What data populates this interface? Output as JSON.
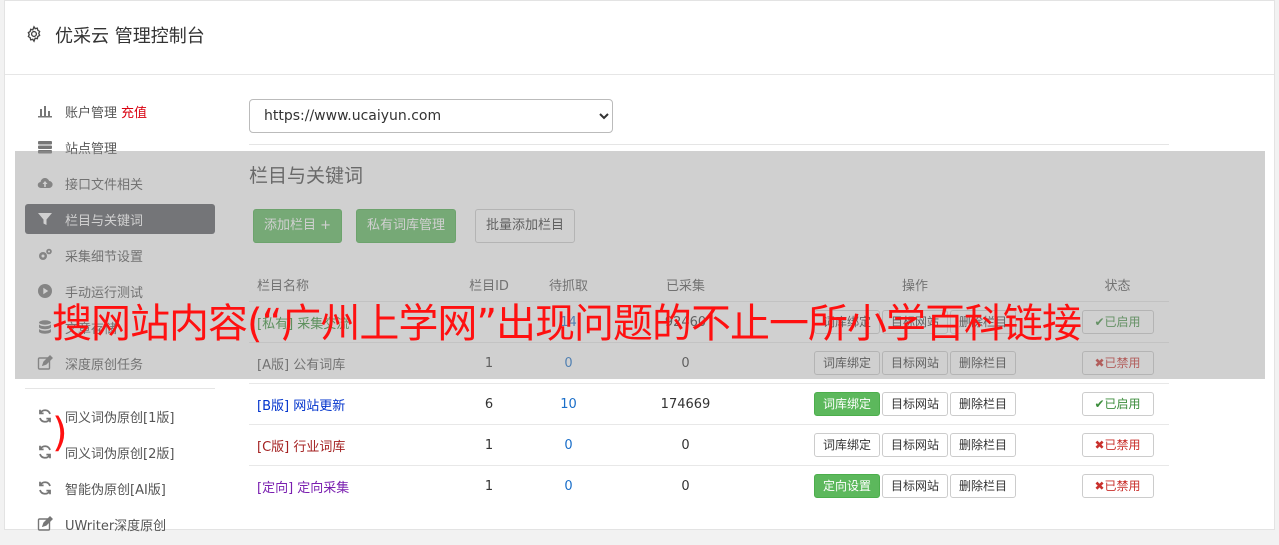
{
  "header": {
    "title": "优采云 管理控制台"
  },
  "sidebar": {
    "items": [
      {
        "label": "账户管理",
        "extra": "充值",
        "icon": "bar-chart-icon"
      },
      {
        "label": "站点管理",
        "icon": "server-icon"
      },
      {
        "label": "接口文件相关",
        "icon": "cloud-upload-icon"
      },
      {
        "label": "栏目与关键词",
        "icon": "filter-icon",
        "active": true
      },
      {
        "label": "采集细节设置",
        "icon": "cogs-icon"
      },
      {
        "label": "手动运行测试",
        "icon": "play-circle-icon"
      },
      {
        "label": "文章存储",
        "icon": "database-icon"
      },
      {
        "label": "深度原创任务",
        "icon": "edit-icon"
      }
    ],
    "tools": [
      {
        "label": "同义词伪原创[1版]",
        "icon": "refresh-icon"
      },
      {
        "label": "同义词伪原创[2版]",
        "icon": "refresh-icon"
      },
      {
        "label": "智能伪原创[AI版]",
        "icon": "refresh-icon"
      },
      {
        "label": "UWriter深度原创",
        "icon": "edit-icon"
      }
    ]
  },
  "main": {
    "site_select": {
      "value": "https://www.ucaiyun.com",
      "options": [
        "https://www.ucaiyun.com"
      ]
    },
    "section_title": "栏目与关键词",
    "buttons": {
      "add": "添加栏目 +",
      "private": "私有词库管理",
      "batch": "批量添加栏目"
    },
    "table": {
      "headers": [
        "栏目名称",
        "栏目ID",
        "待抓取",
        "已采集",
        "操作",
        "状态"
      ],
      "rows": [
        {
          "tag": "[私有]",
          "name": "采集交流",
          "id": "",
          "pending": "14",
          "collected": "92460",
          "btn1": "词库绑定",
          "btn2": "目标网站",
          "btn3": "删除栏目",
          "status": "已启用",
          "status_type": "on",
          "tag_class": "tag-green"
        },
        {
          "tag": "[A版]",
          "name": "公有词库",
          "id": "1",
          "pending": "0",
          "collected": "0",
          "btn1": "词库绑定",
          "btn2": "目标网站",
          "btn3": "删除栏目",
          "status": "已禁用",
          "status_type": "off",
          "tag_class": "tag-gray"
        },
        {
          "tag": "[B版]",
          "name": "网站更新",
          "id": "6",
          "pending": "10",
          "collected": "174669",
          "btn1": "词库绑定",
          "btn2": "目标网站",
          "btn3": "删除栏目",
          "status": "已启用",
          "status_type": "on",
          "tag_class": "tag-blue"
        },
        {
          "tag": "[C版]",
          "name": "行业词库",
          "id": "1",
          "pending": "0",
          "collected": "0",
          "btn1": "词库绑定",
          "btn2": "目标网站",
          "btn3": "删除栏目",
          "status": "已禁用",
          "status_type": "off",
          "tag_class": "tag-red"
        },
        {
          "tag": "[定向]",
          "name": "定向采集",
          "id": "1",
          "pending": "0",
          "collected": "0",
          "btn1": "定向设置",
          "btn2": "目标网站",
          "btn3": "删除栏目",
          "status": "已禁用",
          "status_type": "off",
          "tag_class": "tag-purple"
        }
      ]
    }
  },
  "overlay": {
    "banner": "搜网站内容(“广州上学网”出现问题的不止一所小学百科链接",
    "paren": ")"
  },
  "colors": {
    "accent_green": "#5cb85c",
    "overlay_text": "#ff1010",
    "active_nav": "#58595f"
  }
}
